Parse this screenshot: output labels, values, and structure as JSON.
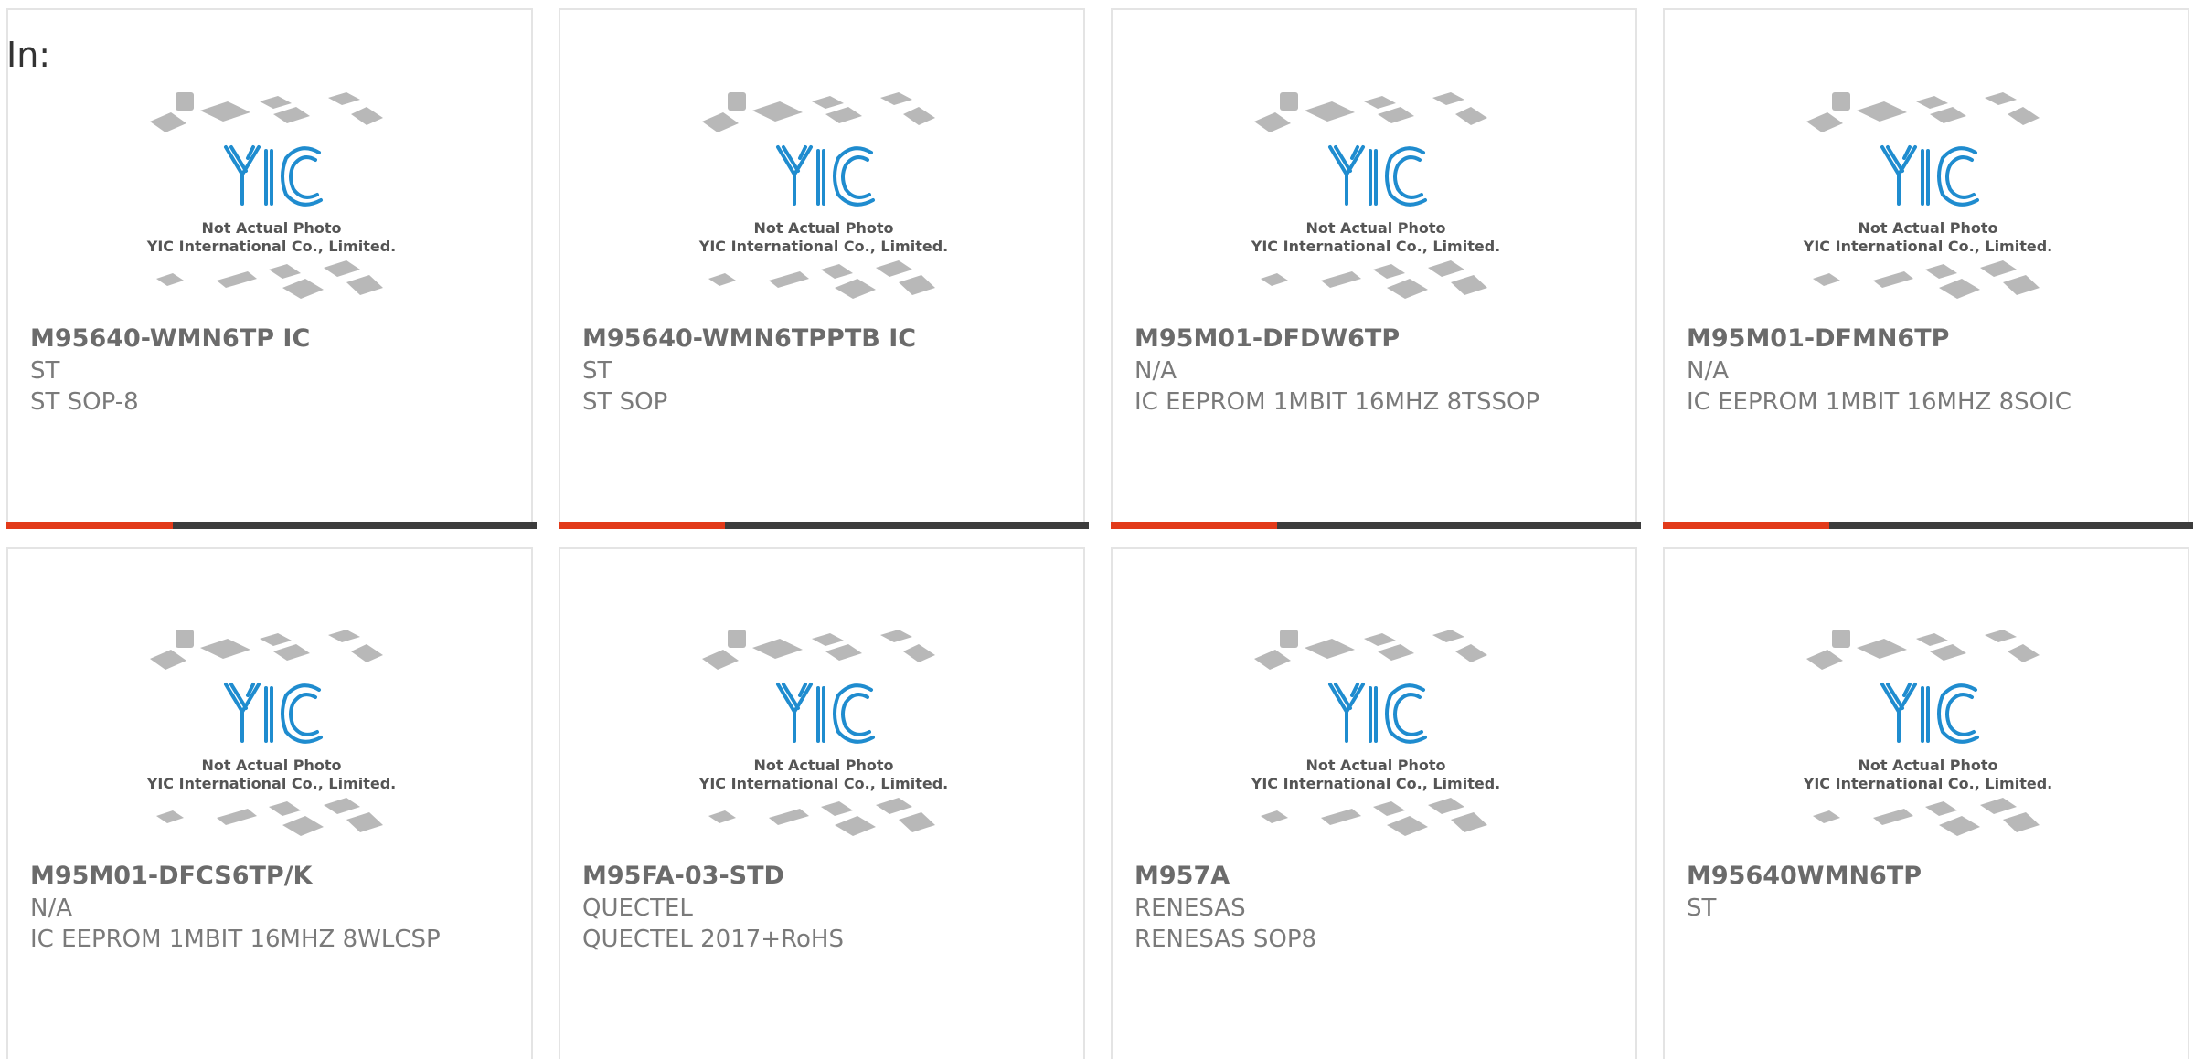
{
  "header": {
    "label": "In:"
  },
  "colors": {
    "accent": "#e23a1a",
    "bar": "#3c3c3c",
    "logo_blue": "#1f8ccf"
  },
  "placeholder_image": {
    "icon": "yic-placeholder-icon",
    "logo_text": "YIC",
    "line1": "Not Actual Photo",
    "line2": "YIC International Co., Limited."
  },
  "products": [
    {
      "part": "M95640-WMN6TP IC",
      "manufacturer": "ST",
      "description": "ST SOP-8"
    },
    {
      "part": "M95640-WMN6TPPTB IC",
      "manufacturer": "ST",
      "description": "ST SOP"
    },
    {
      "part": "M95M01-DFDW6TP",
      "manufacturer": "N/A",
      "description": "IC EEPROM 1MBIT 16MHZ 8TSSOP"
    },
    {
      "part": "M95M01-DFMN6TP",
      "manufacturer": "N/A",
      "description": "IC EEPROM 1MBIT 16MHZ 8SOIC"
    },
    {
      "part": "M95M01-DFCS6TP/K",
      "manufacturer": "N/A",
      "description": "IC EEPROM 1MBIT 16MHZ 8WLCSP"
    },
    {
      "part": "M95FA-03-STD",
      "manufacturer": "QUECTEL",
      "description": "QUECTEL 2017+RoHS"
    },
    {
      "part": "M957A",
      "manufacturer": "RENESAS",
      "description": "RENESAS SOP8"
    },
    {
      "part": "M95640WMN6TP",
      "manufacturer": "ST",
      "description": ""
    }
  ]
}
